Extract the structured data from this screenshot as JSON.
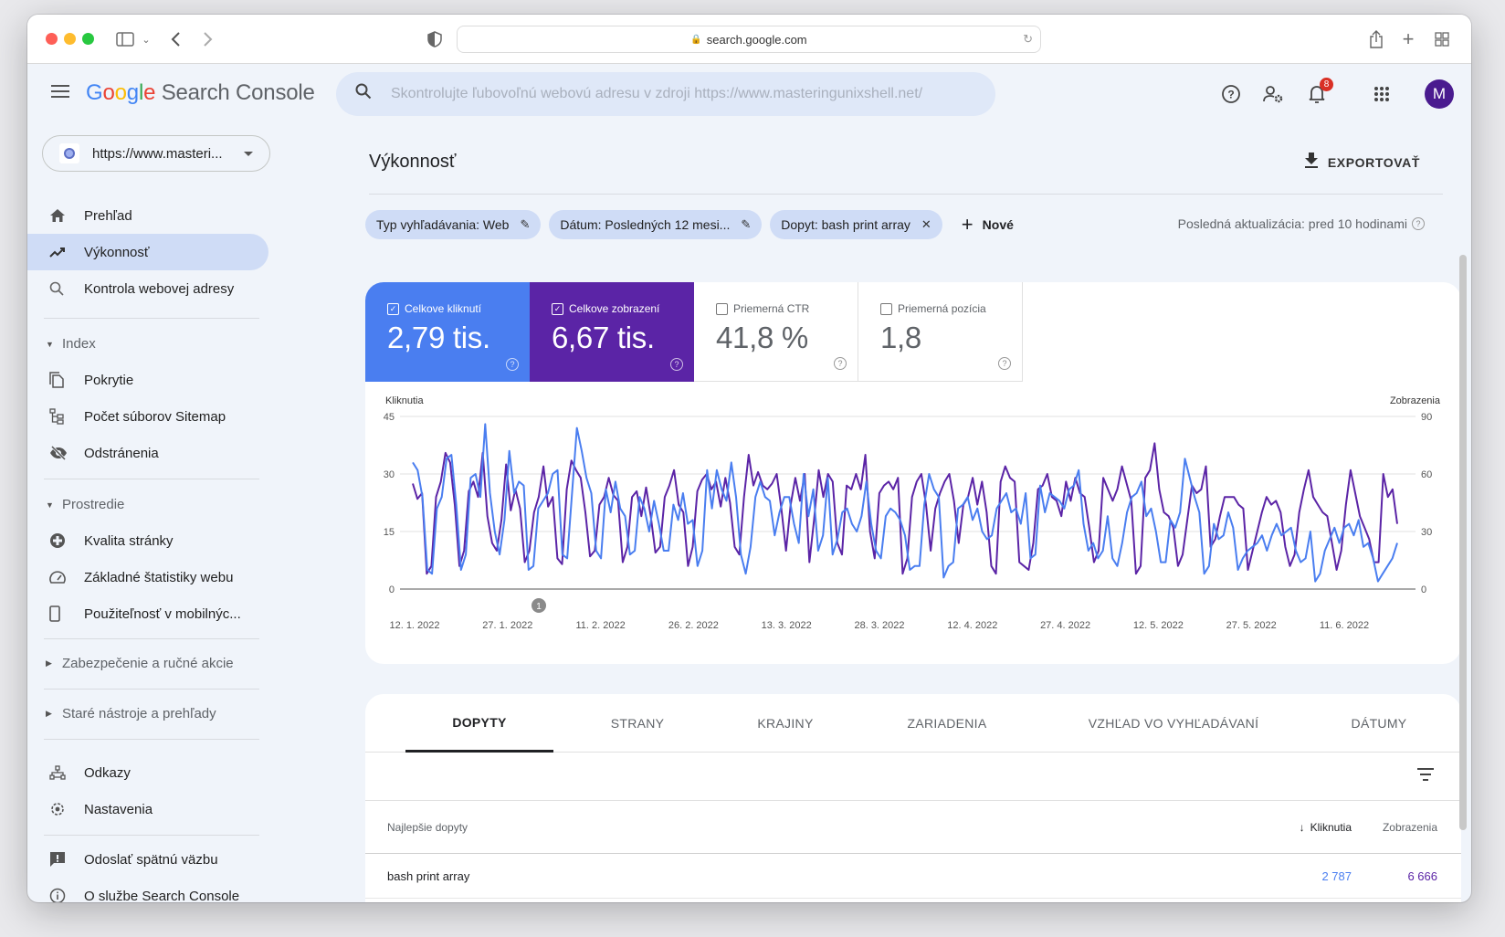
{
  "browser": {
    "url": "search.google.com",
    "icons": [
      "sidebar-toggle-icon",
      "chevron-down-icon",
      "back-icon",
      "forward-icon",
      "shield-icon",
      "reload-icon",
      "share-icon",
      "new-tab-icon",
      "tab-overview-icon"
    ]
  },
  "header": {
    "logo": {
      "g": "G",
      "o1": "o",
      "o2": "o",
      "g2": "g",
      "l": "l",
      "e": "e",
      "product": "Search Console"
    },
    "search_placeholder": "Skontrolujte ľubovoľnú webovú adresu v zdroji https://www.masteringunixshell.net/",
    "notification_count": "8",
    "avatar_letter": "M"
  },
  "sidebar": {
    "property": "https://www.masteri...",
    "items": [
      {
        "label": "Prehľad",
        "icon": "home-icon"
      },
      {
        "label": "Výkonnosť",
        "icon": "trending-icon",
        "active": true
      },
      {
        "label": "Kontrola webovej adresy",
        "icon": "search-icon"
      }
    ],
    "sections": [
      {
        "label": "Index",
        "expanded": true,
        "items": [
          {
            "label": "Pokrytie",
            "icon": "coverage-icon"
          },
          {
            "label": "Počet súborov Sitemap",
            "icon": "sitemap-icon"
          },
          {
            "label": "Odstránenia",
            "icon": "removals-icon"
          }
        ]
      },
      {
        "label": "Prostredie",
        "expanded": true,
        "items": [
          {
            "label": "Kvalita stránky",
            "icon": "page-experience-icon"
          },
          {
            "label": "Základné štatistiky webu",
            "icon": "speedometer-icon"
          },
          {
            "label": "Použiteľnosť v mobilnýc...",
            "icon": "mobile-icon"
          }
        ]
      },
      {
        "label": "Zabezpečenie a ručné akcie",
        "expanded": false
      },
      {
        "label": "Staré nástroje a prehľady",
        "expanded": false
      }
    ],
    "bottom_items": [
      {
        "label": "Odkazy",
        "icon": "links-icon"
      },
      {
        "label": "Nastavenia",
        "icon": "settings-icon"
      },
      {
        "label": "Odoslať spätnú väzbu",
        "icon": "feedback-icon"
      },
      {
        "label": "O službe Search Console",
        "icon": "info-icon"
      }
    ]
  },
  "main": {
    "title": "Výkonnosť",
    "export_label": "EXPORTOVAŤ",
    "filters": [
      {
        "label": "Typ vyhľadávania: Web",
        "action": "edit"
      },
      {
        "label": "Dátum: Posledných 12 mesi...",
        "action": "edit"
      },
      {
        "label": "Dopyt: bash print array",
        "action": "remove"
      }
    ],
    "new_filter_label": "Nové",
    "last_update": "Posledná aktualizácia: pred 10 hodinami",
    "metrics": [
      {
        "label": "Celkove kliknutí",
        "value": "2,79 tis.",
        "checked": true,
        "color": "#4a7ef0"
      },
      {
        "label": "Celkove zobrazení",
        "value": "6,67 tis.",
        "checked": true,
        "color": "#5b24a6"
      },
      {
        "label": "Priemerná CTR",
        "value": "41,8 %",
        "checked": false
      },
      {
        "label": "Priemerná pozícia",
        "value": "1,8",
        "checked": false
      }
    ],
    "annotation_marker": "1"
  },
  "chart_data": {
    "type": "line",
    "title": "",
    "ylabel_left": "Kliknutia",
    "ylabel_right": "Zobrazenia",
    "ylim_left": [
      0,
      45
    ],
    "ylim_right": [
      0,
      90
    ],
    "yticks_left": [
      "0",
      "15",
      "30",
      "45"
    ],
    "yticks_right": [
      "0",
      "30",
      "60",
      "90"
    ],
    "xtick_labels": [
      "12. 1. 2022",
      "27. 1. 2022",
      "11. 2. 2022",
      "26. 2. 2022",
      "13. 3. 2022",
      "28. 3. 2022",
      "12. 4. 2022",
      "27. 4. 2022",
      "12. 5. 2022",
      "27. 5. 2022",
      "11. 6. 2022"
    ],
    "grid": true,
    "series": [
      {
        "name": "Kliknutia",
        "axis": "left",
        "color": "#4a7ef0",
        "values": [
          33,
          31,
          24,
          5,
          4,
          21,
          24,
          34,
          35,
          22,
          5,
          9,
          29,
          30,
          24,
          43,
          25,
          15,
          9,
          18,
          36,
          25,
          28,
          27,
          5,
          6,
          21,
          23,
          25,
          30,
          31,
          9,
          8,
          25,
          42,
          36,
          29,
          25,
          10,
          8,
          26,
          20,
          28,
          21,
          19,
          9,
          10,
          24,
          21,
          15,
          23,
          17,
          10,
          10,
          22,
          18,
          25,
          17,
          18,
          6,
          10,
          31,
          21,
          31,
          26,
          23,
          33,
          24,
          9,
          4,
          11,
          24,
          28,
          24,
          23,
          14,
          20,
          24,
          24,
          17,
          12,
          30,
          19,
          26,
          10,
          14,
          29,
          9,
          13,
          20,
          21,
          17,
          15,
          19,
          28,
          17,
          10,
          8,
          19,
          21,
          20,
          18,
          14,
          5,
          6,
          6,
          22,
          30,
          26,
          24,
          3,
          6,
          7,
          21,
          22,
          24,
          18,
          21,
          15,
          13,
          14,
          21,
          23,
          25,
          20,
          21,
          17,
          25,
          8,
          9,
          27,
          20,
          25,
          24,
          23,
          21,
          26,
          27,
          31,
          17,
          10,
          12,
          8,
          10,
          19,
          8,
          6,
          12,
          20,
          24,
          25,
          28,
          19,
          21,
          15,
          7,
          7,
          18,
          16,
          20,
          34,
          29,
          24,
          20,
          4,
          6,
          17,
          13,
          14,
          20,
          16,
          5,
          8,
          10,
          11,
          12,
          14,
          10,
          14,
          17,
          14,
          15,
          16,
          10,
          7,
          8,
          15,
          2,
          4,
          10,
          13,
          16,
          12,
          16,
          17,
          14,
          18,
          11,
          12,
          8,
          2,
          4,
          6,
          8,
          12
        ],
        "note": "approximate daily values read off chart"
      },
      {
        "name": "Zobrazenia",
        "axis": "right",
        "color": "#5b24a6",
        "values": [
          55,
          47,
          50,
          8,
          12,
          48,
          56,
          71,
          66,
          44,
          12,
          20,
          51,
          56,
          48,
          71,
          38,
          24,
          20,
          36,
          65,
          41,
          52,
          42,
          14,
          20,
          40,
          48,
          64,
          43,
          48,
          16,
          13,
          52,
          67,
          62,
          58,
          40,
          17,
          20,
          44,
          48,
          58,
          49,
          46,
          14,
          22,
          48,
          51,
          38,
          53,
          38,
          19,
          22,
          48,
          54,
          62,
          44,
          40,
          12,
          22,
          51,
          57,
          60,
          52,
          56,
          43,
          58,
          45,
          22,
          18,
          48,
          70,
          54,
          61,
          54,
          52,
          55,
          60,
          42,
          20,
          44,
          58,
          46,
          60,
          14,
          36,
          62,
          48,
          60,
          56,
          24,
          18,
          54,
          52,
          60,
          52,
          70,
          30,
          16,
          50,
          54,
          56,
          52,
          58,
          8,
          16,
          48,
          56,
          60,
          44,
          20,
          42,
          50,
          56,
          60,
          46,
          24,
          44,
          48,
          58,
          44,
          56,
          40,
          12,
          8,
          56,
          64,
          58,
          56,
          14,
          12,
          10,
          24,
          52,
          54,
          60,
          48,
          46,
          38,
          56,
          46,
          58,
          50,
          48,
          32,
          14,
          20,
          58,
          52,
          46,
          52,
          64,
          55,
          46,
          8,
          12,
          58,
          62,
          76,
          52,
          40,
          38,
          32,
          12,
          18,
          36,
          54,
          50,
          52,
          64,
          22,
          26,
          38,
          48,
          48,
          48,
          44,
          42,
          10,
          20,
          30,
          40,
          48,
          44,
          46,
          40,
          22,
          12,
          18,
          40,
          52,
          62,
          48,
          44,
          40,
          38,
          24,
          10,
          20,
          44,
          62,
          50,
          38,
          32,
          26,
          14,
          14,
          60,
          48,
          52,
          34
        ]
      }
    ]
  },
  "table": {
    "tabs": [
      "DOPYTY",
      "STRANY",
      "KRAJINY",
      "ZARIADENIA",
      "VZHĽAD VO VYHĽADÁVANÍ",
      "DÁTUMY"
    ],
    "active_tab": 0,
    "columns": {
      "query": "Najlepšie dopyty",
      "clicks": "Kliknutia",
      "impressions": "Zobrazenia"
    },
    "rows": [
      {
        "query": "bash print array",
        "clicks": "2 787",
        "impressions": "6 666"
      }
    ]
  }
}
